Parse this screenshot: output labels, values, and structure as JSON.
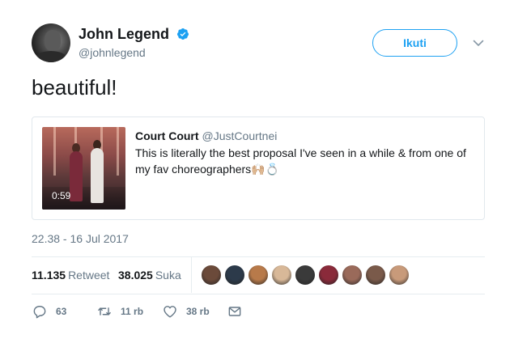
{
  "author": {
    "display_name": "John Legend",
    "handle": "@johnlegend",
    "verified": true
  },
  "follow_button_label": "Ikuti",
  "tweet_text": "beautiful!",
  "quoted_tweet": {
    "display_name": "Court Court",
    "handle": "@JustCourtnei",
    "text": "This is literally the best proposal I've seen in a while & from one of my fav choreographers🙌🏼💍",
    "video_duration": "0:59"
  },
  "timestamp": "22.38 - 16 Jul 2017",
  "stats": {
    "retweet_count": "11.135",
    "retweet_label": "Retweet",
    "like_count": "38.025",
    "like_label": "Suka"
  },
  "likers": [
    {
      "color": "#6b4a3a"
    },
    {
      "color": "#2c3a4a"
    },
    {
      "color": "#b87a4a"
    },
    {
      "color": "#d8b898"
    },
    {
      "color": "#3a3a3a"
    },
    {
      "color": "#8a2a3a"
    },
    {
      "color": "#9a6a5a"
    },
    {
      "color": "#7a5a4a"
    },
    {
      "color": "#c89a7a"
    }
  ],
  "actions": {
    "reply_count": "63",
    "retweet_count": "11 rb",
    "like_count": "38 rb"
  },
  "colors": {
    "accent": "#1da1f2",
    "secondary_text": "#657786",
    "border": "#e1e8ed"
  }
}
